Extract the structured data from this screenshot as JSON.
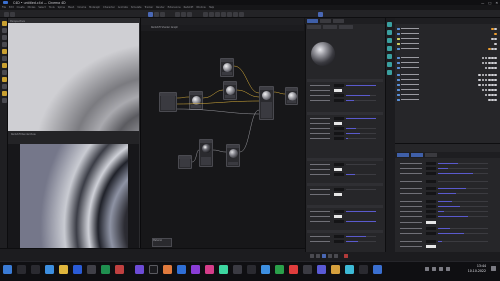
{
  "window": {
    "title": "C4D • untitled.c4d — Cinema 4D",
    "controls": [
      "—",
      "□",
      "✕"
    ]
  },
  "menubar": {
    "items": [
      "File",
      "Edit",
      "Create",
      "Modes",
      "Select",
      "Tools",
      "Spline",
      "Mesh",
      "Volume",
      "MoGraph",
      "Character",
      "Animate",
      "Simulate",
      "Tracker",
      "Render",
      "Extensions",
      "Redshift",
      "Window",
      "Help"
    ]
  },
  "viewport": {
    "top_label": "Perspective",
    "bottom_label": "Redshift RenderView"
  },
  "node_editor": {
    "header_label": "Redshift Shader Graph",
    "tag_label": "Material"
  },
  "icons": {
    "app": "cinema4d-icon",
    "start": "windows-start-icon",
    "search": "search-icon"
  },
  "colors": {
    "accent": "#3f5fa8",
    "slider": "#5a5acd",
    "wire": "#e0b43c",
    "background": "#1b1b1d"
  },
  "taskbar": {
    "time": "13:44",
    "date": "10.10.2022"
  }
}
